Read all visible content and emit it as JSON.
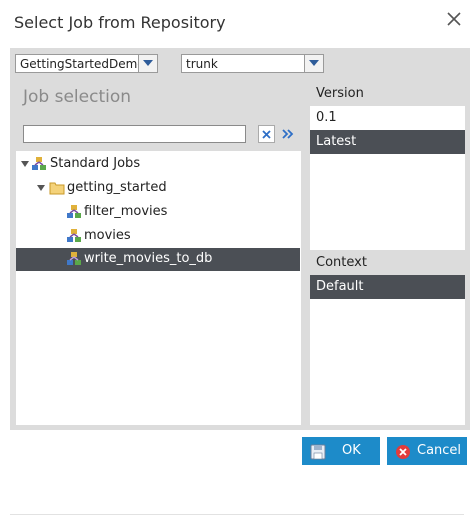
{
  "dialog": {
    "title": "Select Job from Repository",
    "close_icon": "close-icon"
  },
  "selectors": {
    "project": {
      "value": "GettingStartedDemo"
    },
    "branch": {
      "value": "trunk"
    }
  },
  "job_panel": {
    "heading": "Job selection",
    "search": {
      "value": "",
      "placeholder": ""
    },
    "clear_icon": "clear-x-icon",
    "expand_icon": "double-chevron-right-icon"
  },
  "tree": {
    "root": {
      "label": "Standard Jobs",
      "icon": "job-icon"
    },
    "folder": {
      "label": "getting_started",
      "icon": "folder-icon"
    },
    "jobs": [
      {
        "label": "filter_movies",
        "icon": "job-icon",
        "selected": false
      },
      {
        "label": "movies",
        "icon": "job-icon",
        "selected": false
      },
      {
        "label": "write_movies_to_db",
        "icon": "job-icon",
        "selected": true
      }
    ]
  },
  "version": {
    "header": "Version",
    "rows": [
      {
        "label": "0.1",
        "selected": false
      },
      {
        "label": "Latest",
        "selected": true
      }
    ]
  },
  "context": {
    "header": "Context",
    "rows": [
      {
        "label": "Default",
        "selected": true
      }
    ]
  },
  "buttons": {
    "ok": {
      "label": "OK",
      "icon": "save-icon"
    },
    "cancel": {
      "label": "Cancel",
      "icon": "cancel-icon"
    }
  },
  "colors": {
    "accent": "#1d8bc9",
    "selection": "#4b4f55",
    "panel_bg": "#dcdcdc"
  }
}
